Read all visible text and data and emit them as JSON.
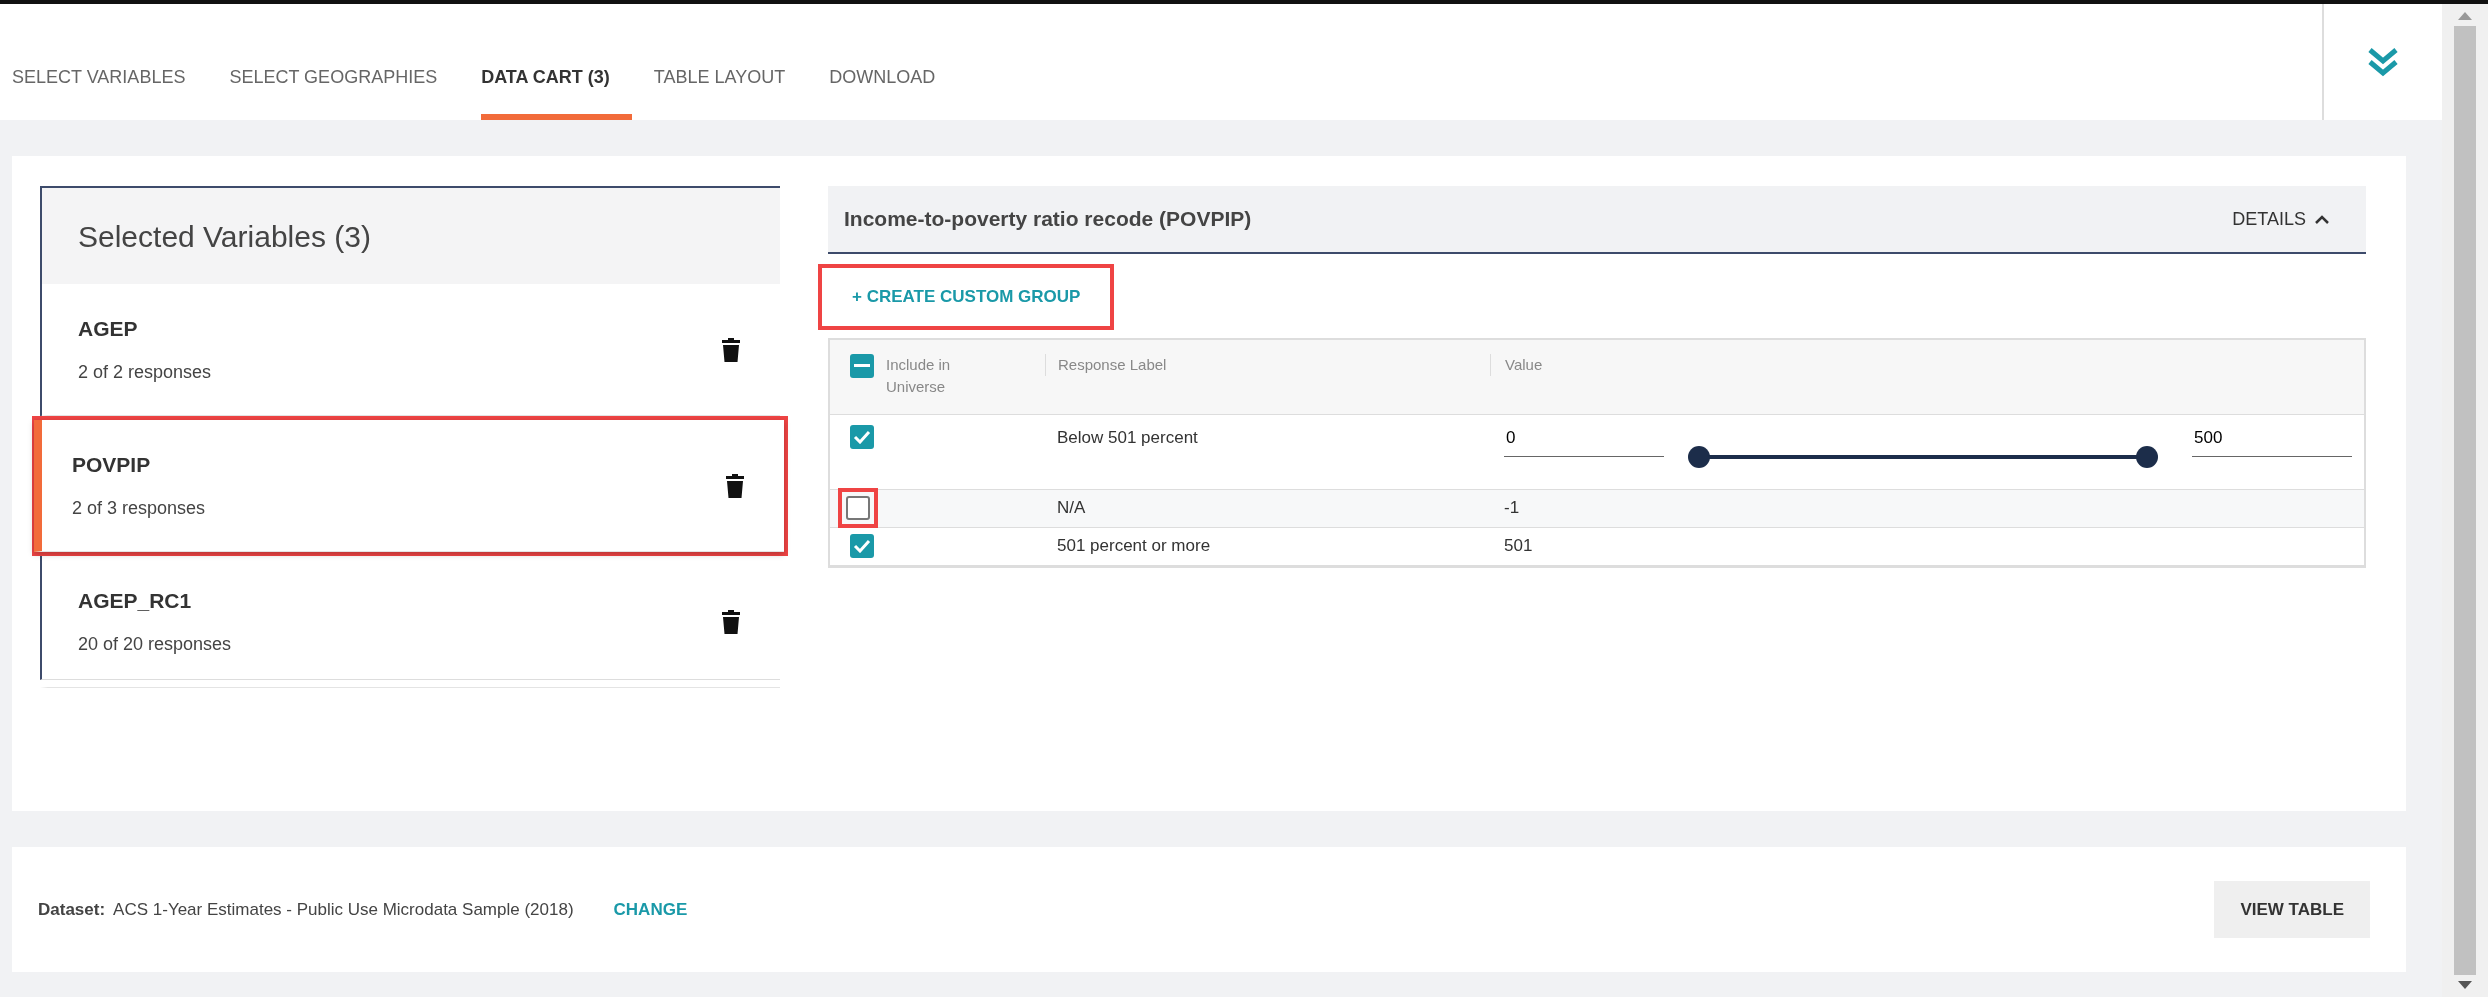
{
  "tabs": [
    {
      "label": "SELECT VARIABLES",
      "selected": false
    },
    {
      "label": "SELECT GEOGRAPHIES",
      "selected": false
    },
    {
      "label": "DATA CART (3)",
      "selected": true
    },
    {
      "label": "TABLE LAYOUT",
      "selected": false
    },
    {
      "label": "DOWNLOAD",
      "selected": false
    }
  ],
  "selected_variables": {
    "title": "Selected Variables (3)",
    "items": [
      {
        "name": "AGEP",
        "responses": "2 of 2 responses",
        "selected": false,
        "annotated": false
      },
      {
        "name": "POVPIP",
        "responses": "2 of 3 responses",
        "selected": true,
        "annotated": true
      },
      {
        "name": "AGEP_RC1",
        "responses": "20 of 20 responses",
        "selected": false,
        "annotated": false
      }
    ]
  },
  "detail": {
    "title": "Income-to-poverty ratio recode (POVPIP)",
    "details_button": "DETAILS",
    "expanded": true,
    "create_button": {
      "label": "+ CREATE CUSTOM GROUP",
      "annotated": true
    },
    "columns": [
      {
        "label": "Include in Universe",
        "indeterminate": true
      },
      {
        "label": "Response Label"
      },
      {
        "label": "Value"
      }
    ],
    "rows": [
      {
        "kind": "range",
        "checked": true,
        "annotated": false,
        "label": "Below 501 percent",
        "min_value": "0",
        "max_value": "500",
        "level": 1
      },
      {
        "kind": "plain",
        "checked": false,
        "annotated": true,
        "label": "N/A",
        "value": "-1"
      },
      {
        "kind": "plain",
        "checked": true,
        "annotated": false,
        "label": "501 percent or more",
        "value": "501"
      }
    ]
  },
  "footer": {
    "dataset_label": "Dataset:",
    "dataset": "ACS 1-Year Estimates - Public Use Microdata Sample (2018)",
    "change_link": "CHANGE",
    "view_button": "VIEW TABLE"
  }
}
